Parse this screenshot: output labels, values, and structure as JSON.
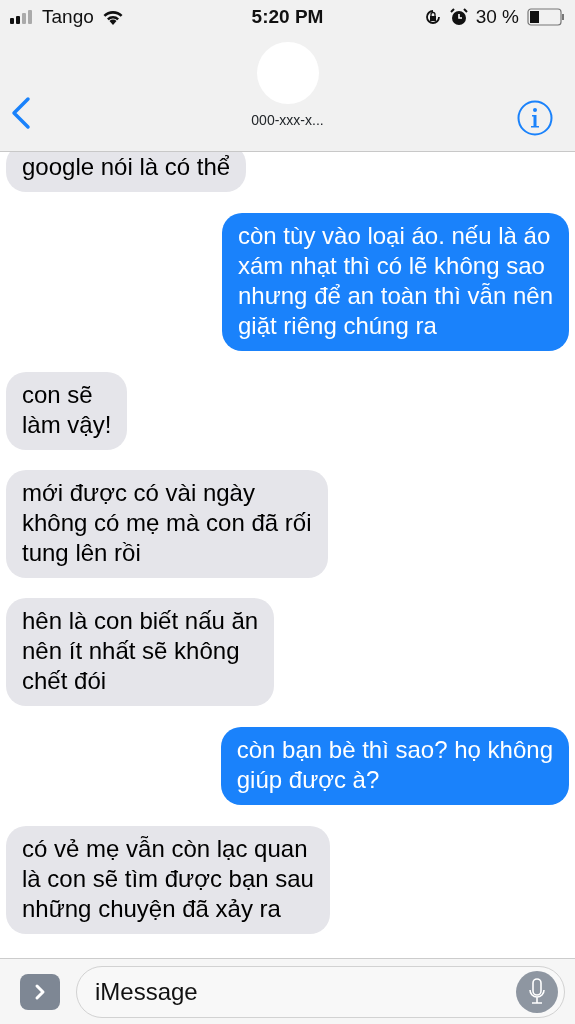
{
  "status_bar": {
    "carrier": "Tango",
    "time": "5:20 PM",
    "battery": "30 %"
  },
  "header": {
    "contact": "000-xxx-x..."
  },
  "messages": [
    {
      "kind": "received",
      "lines": [
        "google nói là có thể"
      ]
    },
    {
      "kind": "sent",
      "lines": [
        "còn tùy vào loại áo. nếu là áo",
        "xám nhạt thì có lẽ không sao",
        "nhưng để an toàn thì vẫn nên",
        "giặt riêng chúng ra"
      ]
    },
    {
      "kind": "received",
      "lines": [
        "con sẽ",
        "làm vậy!"
      ]
    },
    {
      "kind": "received",
      "lines": [
        "mới được có vài ngày",
        "không có mẹ mà con đã rối",
        "tung lên rồi"
      ]
    },
    {
      "kind": "received",
      "lines": [
        "hên là con biết nấu ăn",
        "nên ít nhất sẽ không",
        "chết đói"
      ]
    },
    {
      "kind": "sent",
      "lines": [
        "còn bạn bè thì sao? họ không",
        "giúp được à?"
      ]
    },
    {
      "kind": "received",
      "lines": [
        "có vẻ mẹ vẫn còn lạc quan",
        "là con sẽ tìm được bạn sau",
        "những chuyện đã xảy ra"
      ]
    }
  ],
  "composer": {
    "placeholder": "iMessage"
  }
}
